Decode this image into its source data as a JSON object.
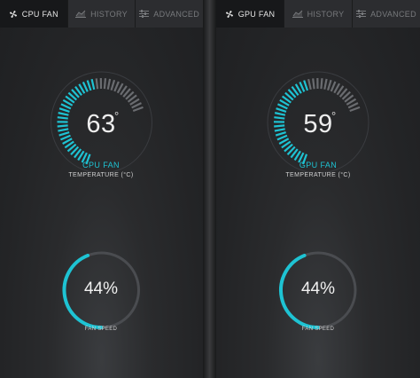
{
  "colors": {
    "accent": "#1ec3d3",
    "inactive_tick": "#6a6c70",
    "ring_track": "#4a4c50"
  },
  "icons": {
    "fan": "fan-icon",
    "history": "chart-icon",
    "advanced": "sliders-icon"
  },
  "panels": [
    {
      "tabs": [
        {
          "label": "CPU FAN",
          "active": true
        },
        {
          "label": "HISTORY",
          "active": false
        },
        {
          "label": "ADVANCED",
          "active": false
        }
      ],
      "temperature": {
        "value": "63",
        "degree": "°",
        "label": "CPU FAN",
        "sublabel": "TEMPERATURE (°C)",
        "active_fraction": 0.66
      },
      "fan": {
        "value": "44%",
        "label": "FAN SPEED",
        "fraction": 0.44
      }
    },
    {
      "tabs": [
        {
          "label": "GPU FAN",
          "active": true
        },
        {
          "label": "HISTORY",
          "active": false
        },
        {
          "label": "ADVANCED",
          "active": false
        }
      ],
      "temperature": {
        "value": "59",
        "degree": "°",
        "label": "GPU FAN",
        "sublabel": "TEMPERATURE (°C)",
        "active_fraction": 0.62
      },
      "fan": {
        "value": "44%",
        "label": "FAN SPEED",
        "fraction": 0.44
      }
    }
  ]
}
